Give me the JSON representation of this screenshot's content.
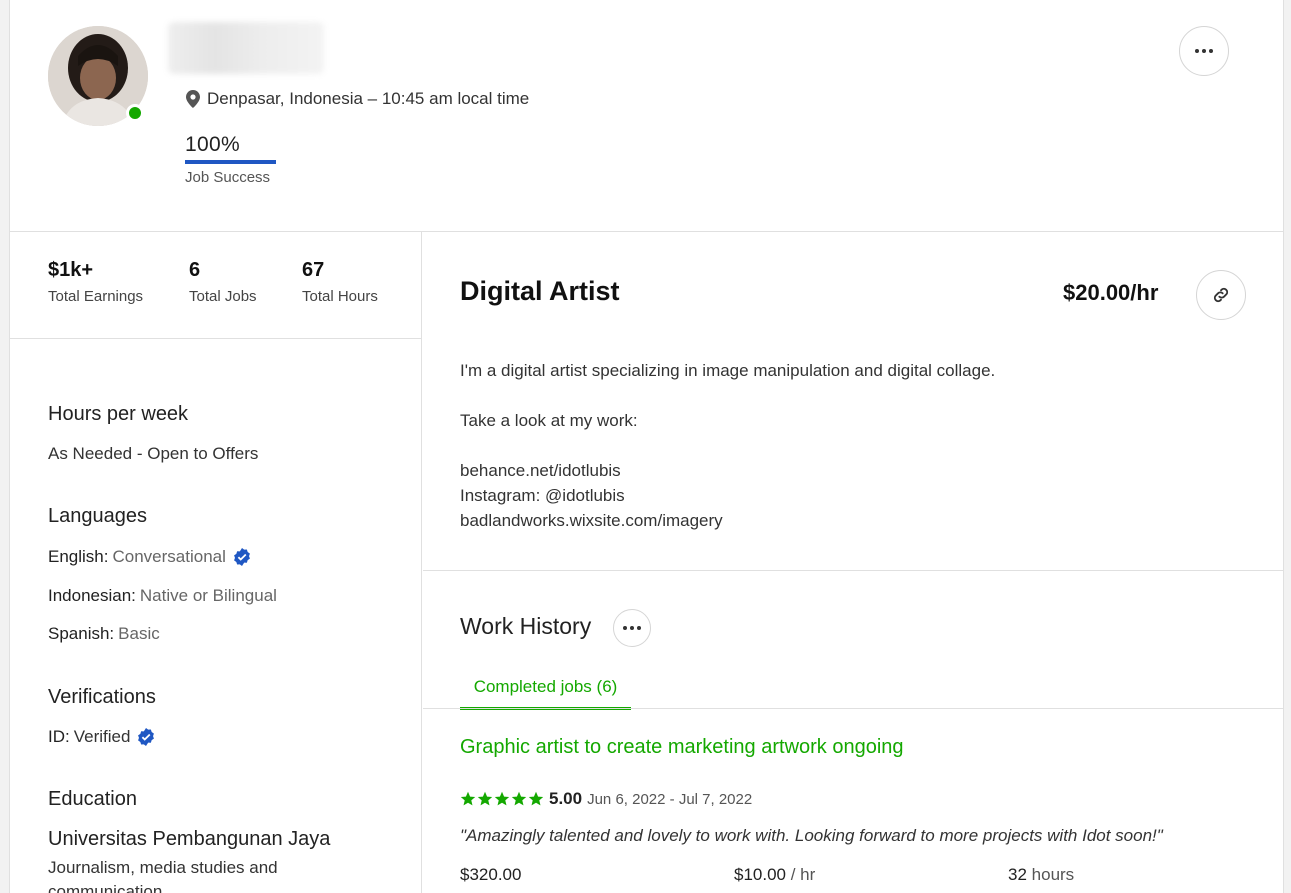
{
  "header": {
    "location": "Denpasar, Indonesia – 10:45 am local time",
    "job_success": {
      "value": "100%",
      "label": "Job Success"
    }
  },
  "stats": [
    {
      "value": "$1k+",
      "label": "Total Earnings"
    },
    {
      "value": "6",
      "label": "Total Jobs"
    },
    {
      "value": "67",
      "label": "Total Hours"
    }
  ],
  "sidebar": {
    "hours": {
      "title": "Hours per week",
      "value": "As Needed - Open to Offers"
    },
    "languages": {
      "title": "Languages",
      "items": [
        {
          "name": "English:",
          "level": "Conversational",
          "verified": true
        },
        {
          "name": "Indonesian:",
          "level": "Native or Bilingual",
          "verified": false
        },
        {
          "name": "Spanish:",
          "level": "Basic",
          "verified": false
        }
      ]
    },
    "verifications": {
      "title": "Verifications",
      "id_label": "ID:",
      "id_value": "Verified"
    },
    "education": {
      "title": "Education",
      "school": "Universitas Pembangunan Jaya",
      "field": "Journalism, media studies and communication"
    }
  },
  "profile": {
    "title": "Digital Artist",
    "rate": "$20.00/hr",
    "description": [
      "I'm a digital artist specializing in image manipulation and digital collage.",
      "",
      "Take a look at my work:",
      "",
      "behance.net/idotlubis",
      "Instagram: @idotlubis",
      "badlandworks.wixsite.com/imagery"
    ]
  },
  "work_history": {
    "title": "Work History",
    "tab_label": "Completed jobs (6)",
    "jobs": [
      {
        "title": "Graphic artist to create marketing artwork ongoing",
        "stars": 5,
        "rating": "5.00",
        "dates": "Jun 6, 2022 - Jul 7, 2022",
        "feedback": "\"Amazingly talented and lovely to work with. Looking forward to more projects with Idot soon!\"",
        "earned": "$320.00",
        "hourly_rate": "$10.00",
        "hourly_unit": "/ hr",
        "hours": "32",
        "hours_unit": "hours"
      }
    ]
  },
  "colors": {
    "accent_green": "#14a800",
    "jss_blue": "#1f57c3",
    "verified_blue": "#1f57c3"
  },
  "icons": [
    "location-pin-icon",
    "more-dots-icon",
    "link-icon",
    "verified-badge-icon",
    "star-icon",
    "online-status-icon"
  ]
}
